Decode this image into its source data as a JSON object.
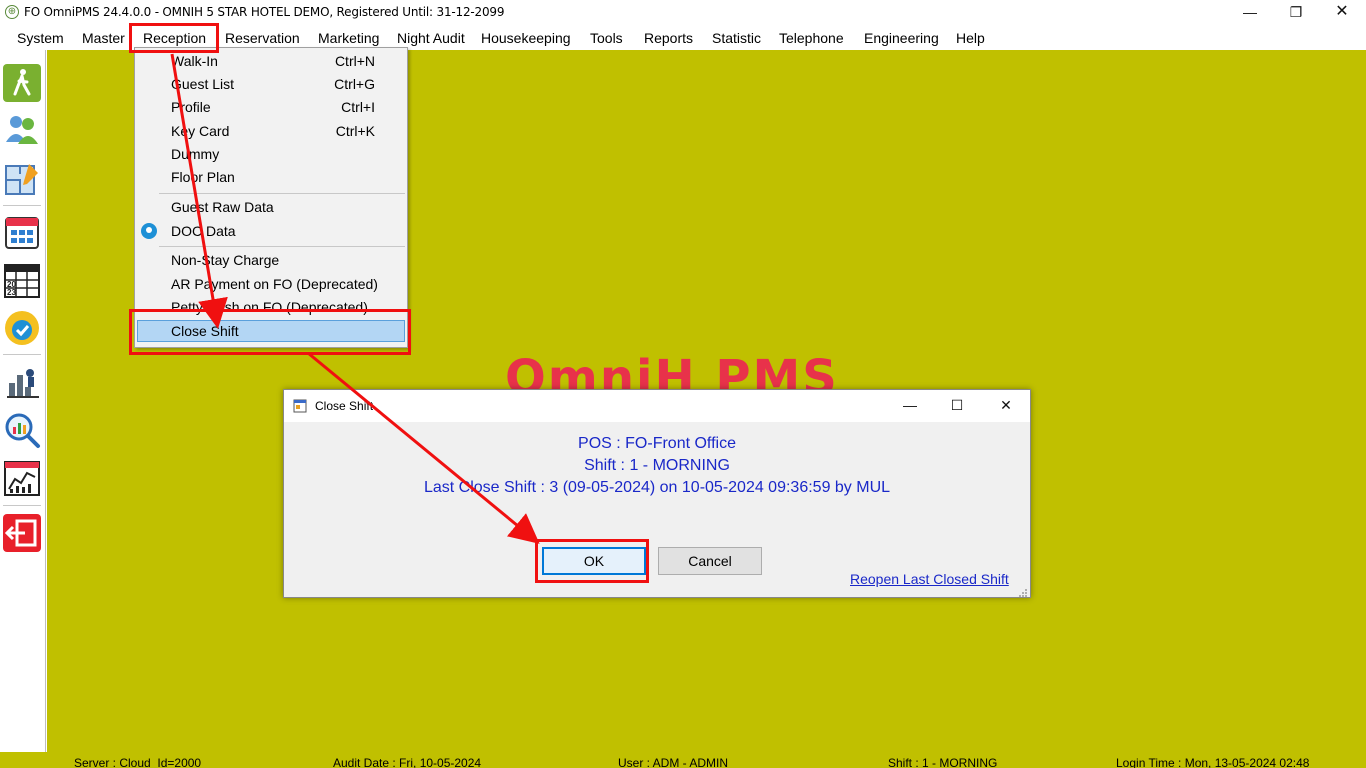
{
  "window": {
    "title": "FO OmniPMS 24.4.0.0 - OMNIH 5 STAR HOTEL DEMO, Registered Until: 31-12-2099",
    "minimize": "—",
    "maximize": "❐",
    "close": "✕"
  },
  "menubar": [
    "System",
    "Master",
    "Reception",
    "Reservation",
    "Marketing",
    "Night Audit",
    "Housekeeping",
    "Tools",
    "Reports",
    "Statistic",
    "Telephone",
    "Engineering",
    "Help"
  ],
  "reception_menu": {
    "walk_in": {
      "label": "Walk-In",
      "shortcut": "Ctrl+N"
    },
    "guest_list": {
      "label": "Guest List",
      "shortcut": "Ctrl+G"
    },
    "profile": {
      "label": "Profile",
      "shortcut": "Ctrl+I"
    },
    "key_card": {
      "label": "Key Card",
      "shortcut": "Ctrl+K"
    },
    "dummy": {
      "label": "Dummy"
    },
    "floor_plan": {
      "label": "Floor Plan"
    },
    "guest_raw_data": {
      "label": "Guest Raw Data"
    },
    "doc_data": {
      "label": "DOC Data"
    },
    "non_stay_charge": {
      "label": "Non-Stay Charge"
    },
    "ar_payment": {
      "label": "AR Payment on FO (Deprecated)"
    },
    "petty_cash": {
      "label": "Petty Cash on FO (Deprecated)"
    },
    "close_shift": {
      "label": "Close Shift"
    }
  },
  "background_logo": "OmniH PMS",
  "dialog": {
    "title": "Close Shift",
    "pos": "POS : FO-Front Office",
    "shift": "Shift : 1 - MORNING",
    "last_close": "Last Close Shift : 3 (09-05-2024) on 10-05-2024 09:36:59 by MUL",
    "ok": "OK",
    "cancel": "Cancel",
    "reopen": "Reopen Last Closed Shift",
    "min": "—",
    "max": "☐",
    "close": "✕"
  },
  "statusbar": {
    "server": "Server : Cloud_Id=2000",
    "audit_date": "Audit Date : Fri, 10-05-2024",
    "user": "User : ADM - ADMIN",
    "shift": "Shift : 1 - MORNING",
    "login_time": "Login Time : Mon, 13-05-2024 02:48"
  },
  "toolbar_icons": [
    "walk-in-icon",
    "guest-list-icon",
    "floor-plan-icon",
    "calendar-grid-icon",
    "calendar-2023-icon",
    "available-check-icon",
    "housekeeping-icon",
    "statistic-search-icon",
    "report-chart-icon",
    "exit-icon"
  ],
  "colors": {
    "background": "#c0c000",
    "accent": "#1a28c8",
    "annotation": "#f01010",
    "logo": "#e8324a"
  }
}
